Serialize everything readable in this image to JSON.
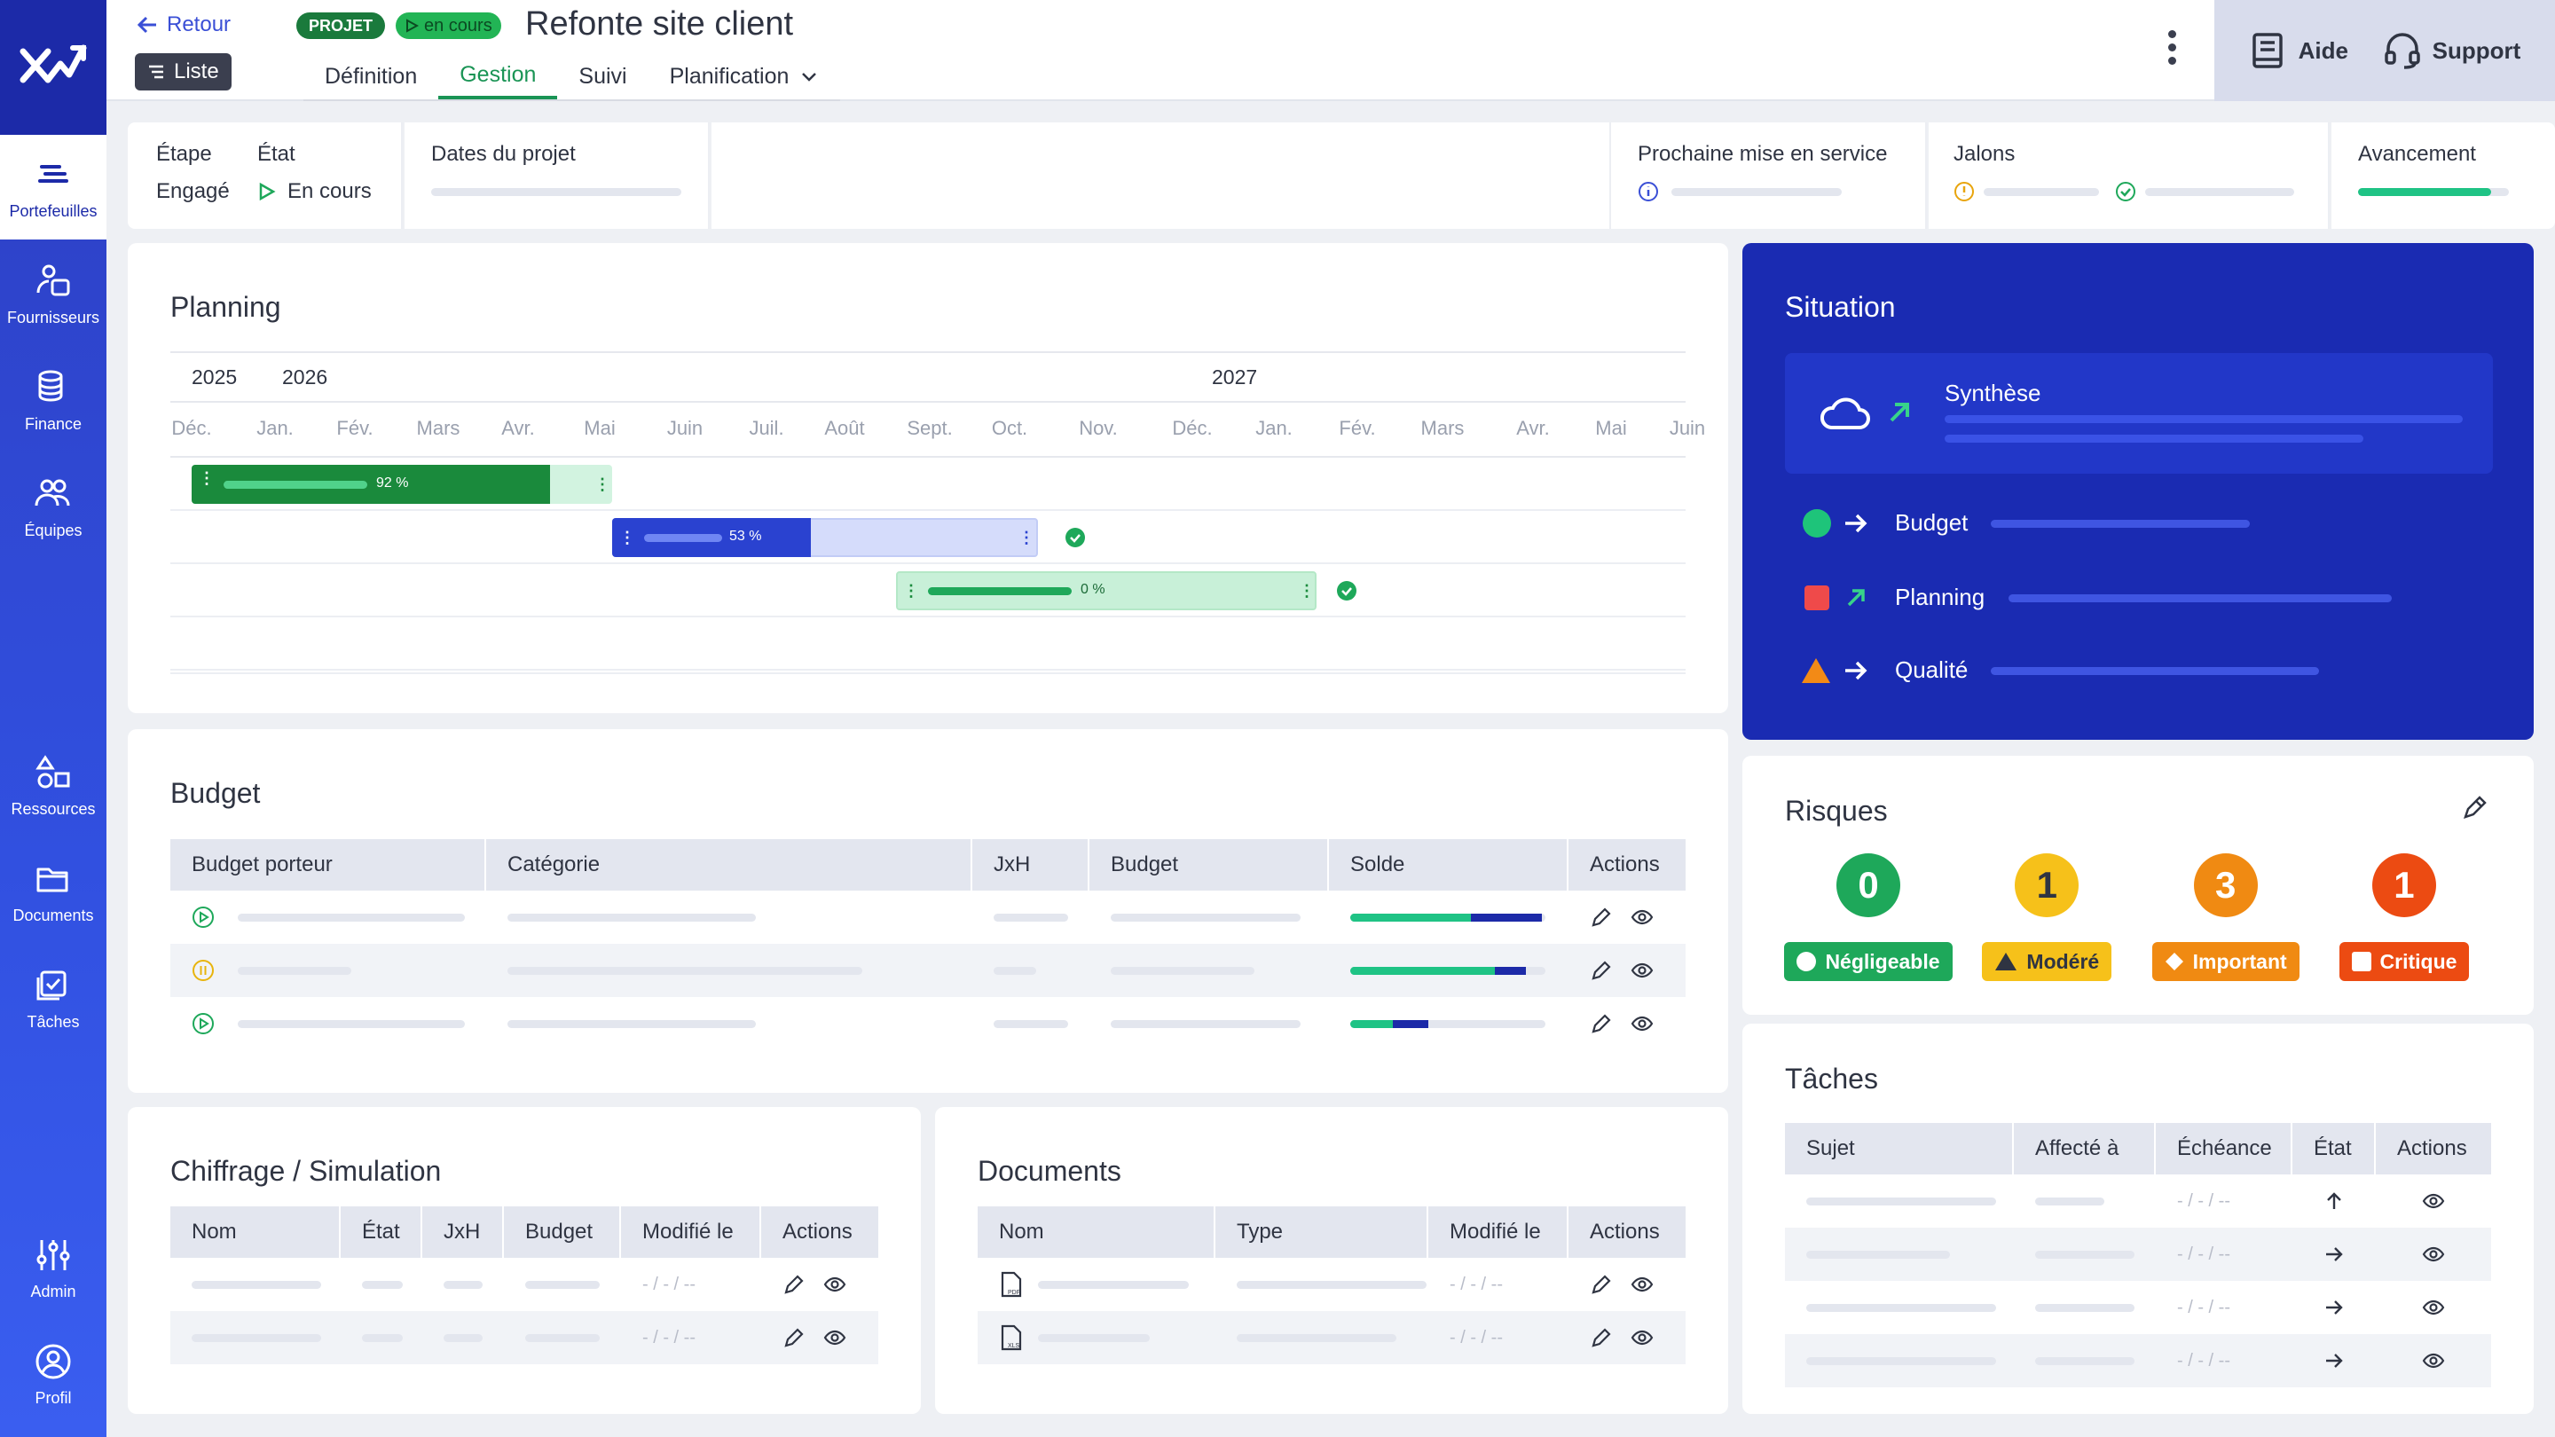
{
  "nav": {
    "items": [
      {
        "label": "Portefeuilles",
        "icon": "portfolio-icon"
      },
      {
        "label": "Fournisseurs",
        "icon": "supplier-icon"
      },
      {
        "label": "Finance",
        "icon": "finance-icon"
      },
      {
        "label": "Équipes",
        "icon": "team-icon"
      },
      {
        "label": "Ressources",
        "icon": "resources-icon"
      },
      {
        "label": "Documents",
        "icon": "folder-icon"
      },
      {
        "label": "Tâches",
        "icon": "tasks-icon"
      },
      {
        "label": "Admin",
        "icon": "sliders-icon"
      },
      {
        "label": "Profil",
        "icon": "profile-icon"
      }
    ]
  },
  "header": {
    "back_label": "Retour",
    "list_label": "Liste",
    "type_tag": "PROJET",
    "status_tag": "en cours",
    "title": "Refonte site client",
    "tabs": [
      "Définition",
      "Gestion",
      "Suivi",
      "Planification"
    ],
    "help_label": "Aide",
    "support_label": "Support"
  },
  "info": {
    "step_label": "Étape",
    "step_value": "Engagé",
    "state_label": "État",
    "state_value": "En cours",
    "dates_label": "Dates du projet",
    "next_label": "Prochaine mise en service",
    "milestones_label": "Jalons",
    "progress_label": "Avancement",
    "progress_value": 0.88
  },
  "planning": {
    "title": "Planning",
    "years": [
      "2025",
      "2026",
      "2027"
    ],
    "months": [
      "Déc.",
      "Jan.",
      "Fév.",
      "Mars",
      "Avr.",
      "Mai",
      "Juin",
      "Juil.",
      "Août",
      "Sept.",
      "Oct.",
      "Nov.",
      "Déc.",
      "Jan.",
      "Fév.",
      "Mars",
      "Avr.",
      "Mai",
      "Juin"
    ],
    "bars": [
      {
        "label": "92 %",
        "progress": 0.92
      },
      {
        "label": "53 %",
        "progress": 0.53
      },
      {
        "label": "0 %",
        "progress": 0.0
      }
    ]
  },
  "situation": {
    "title": "Situation",
    "summary_label": "Synthèse",
    "items": [
      {
        "label": "Budget",
        "status": "green",
        "trend": "stable"
      },
      {
        "label": "Planning",
        "status": "red",
        "trend": "up"
      },
      {
        "label": "Qualité",
        "status": "orange",
        "trend": "stable"
      }
    ]
  },
  "budget": {
    "title": "Budget",
    "columns": [
      "Budget porteur",
      "Catégorie",
      "JxH",
      "Budget",
      "Solde",
      "Actions"
    ],
    "rows": [
      {
        "status": "play",
        "solde_green": 0.62,
        "solde_blue": 0.36
      },
      {
        "status": "pause",
        "solde_green": 0.74,
        "solde_blue": 0.16
      },
      {
        "status": "play",
        "solde_green": 0.22,
        "solde_blue": 0.18
      }
    ]
  },
  "risques": {
    "title": "Risques",
    "items": [
      {
        "count": "0",
        "label": "Négligeable",
        "color": "#1ea85a"
      },
      {
        "count": "1",
        "label": "Modéré",
        "color": "#f6c11a"
      },
      {
        "count": "3",
        "label": "Important",
        "color": "#f08a12"
      },
      {
        "count": "1",
        "label": "Critique",
        "color": "#ec4b12"
      }
    ]
  },
  "chiffrage": {
    "title": "Chiffrage / Simulation",
    "columns": [
      "Nom",
      "État",
      "JxH",
      "Budget",
      "Modifié le",
      "Actions"
    ],
    "date_placeholder": "- / - / --"
  },
  "documents": {
    "title": "Documents",
    "columns": [
      "Nom",
      "Type",
      "Modifié le",
      "Actions"
    ],
    "date_placeholder": "- / - / --"
  },
  "taches": {
    "title": "Tâches",
    "columns": [
      "Sujet",
      "Affecté à",
      "Échéance",
      "État",
      "Actions"
    ],
    "date_placeholder": "- / - / --"
  }
}
